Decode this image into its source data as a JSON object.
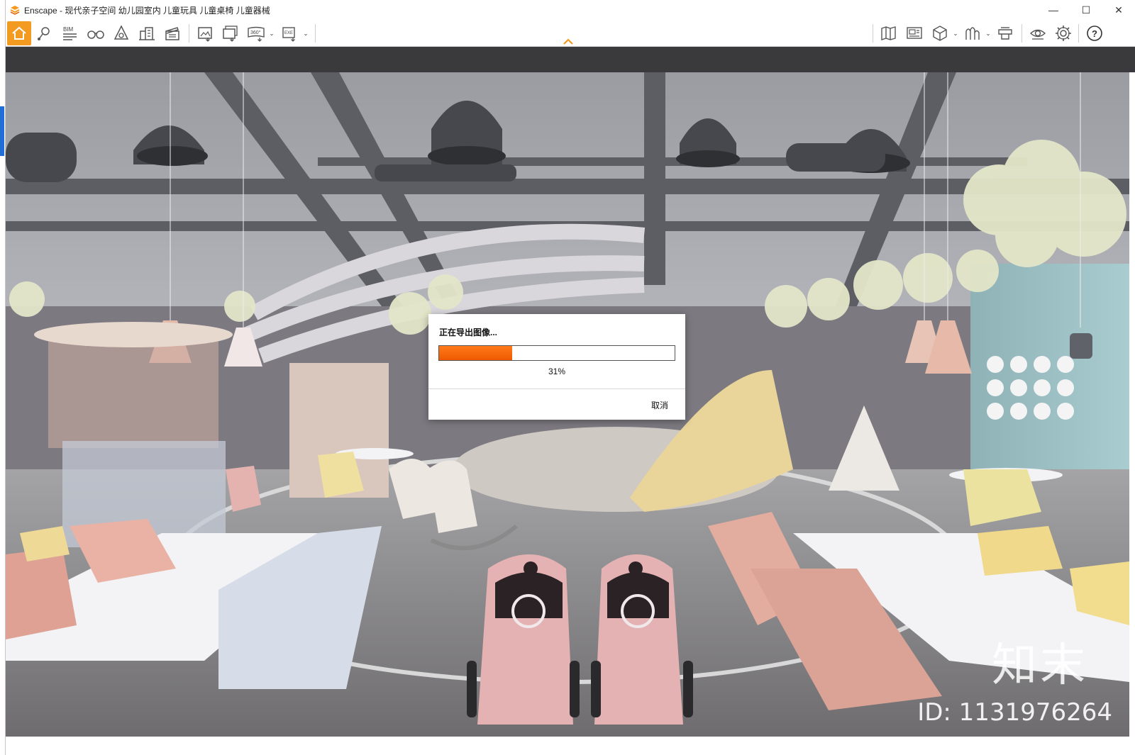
{
  "window": {
    "title": "Enscape - 现代亲子空间 幼儿园室内 儿童玩具 儿童桌椅 儿童器械",
    "minimize_glyph": "—",
    "maximize_glyph": "☐",
    "close_glyph": "✕"
  },
  "toolbar": {
    "left_buttons": [
      "home-icon",
      "location-pin-icon",
      "bim-icon",
      "binoculars-icon",
      "cone-icon",
      "buildings-icon",
      "clapperboard-icon",
      "screenshot-icon",
      "batch-render-icon",
      "panorama-360-icon",
      "export-exe-icon"
    ],
    "right_buttons": [
      "map-icon",
      "capture-view-icon",
      "cube-icon",
      "asset-library-icon",
      "material-editor-icon",
      "visual-settings-icon",
      "settings-icon",
      "help-icon"
    ],
    "bim_label": "BIM",
    "pano_label": "360°",
    "exe_label": "EXE"
  },
  "dialog": {
    "title": "正在导出图像...",
    "progress": 0.31,
    "progress_text": "31%",
    "cancel_label": "取消"
  },
  "watermark": {
    "logo_text": "知末",
    "id_text": "ID: 1131976264"
  },
  "colors": {
    "accent": "#f39a21",
    "progress": "#ff7a1a"
  }
}
